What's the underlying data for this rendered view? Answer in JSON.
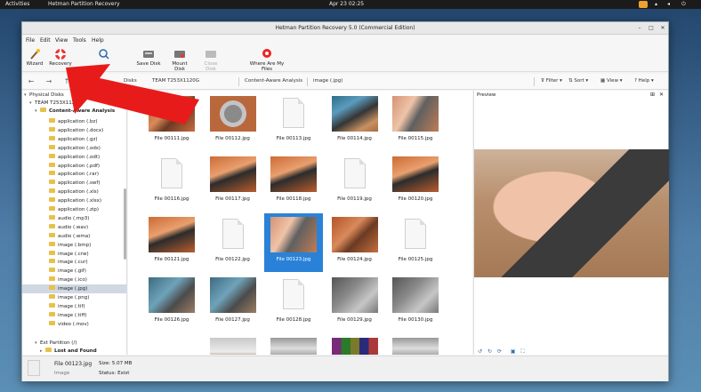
{
  "topbar": {
    "activities": "Activities",
    "app": "Hetman Partition Recovery",
    "clock": "Apr 23  02:25"
  },
  "window": {
    "title": "Hetman Partition Recovery 5.0 (Commercial Edition)"
  },
  "menu": [
    "File",
    "Edit",
    "View",
    "Tools",
    "Help"
  ],
  "toolbar": {
    "wizard": "Wizard",
    "recovery": "Recovery",
    "save_disk": "Save Disk",
    "mount_disk": "Mount Disk",
    "close_disk": "Close Disk",
    "where": "Where Are My Files"
  },
  "breadcrumbs": [
    "Disks",
    "TEAM T253X1120G",
    "Content-Aware Analysis",
    "image (.jpg)"
  ],
  "right_tools": {
    "filter": "Filter",
    "sort": "Sort",
    "view": "View",
    "help": "Help"
  },
  "tree": {
    "physical": "Physical Disks",
    "disk": "TEAM T253X1120G",
    "analysis": "Content-Aware Analysis",
    "items": [
      "application (.bz)",
      "application (.docx)",
      "application (.gz)",
      "application (.ods)",
      "application (.odt)",
      "application (.pdf)",
      "application (.rar)",
      "application (.swf)",
      "application (.xls)",
      "application (.xlsx)",
      "application (.zip)",
      "audio (.mp3)",
      "audio (.wav)",
      "audio (.wma)",
      "image (.bmp)",
      "image (.crw)",
      "image (.cur)",
      "image (.gif)",
      "image (.ico)",
      "image (.jpg)",
      "image (.png)",
      "image (.tif)",
      "image (.tiff)",
      "video (.mov)"
    ],
    "ext": "Ext Partition (/)",
    "lost": "Lost and Found"
  },
  "files": [
    "File 00111.jpg",
    "File 00112.jpg",
    "File 00113.jpg",
    "File 00114.jpg",
    "File 00115.jpg",
    "File 00116.jpg",
    "File 00117.jpg",
    "File 00118.jpg",
    "File 00119.jpg",
    "File 00120.jpg",
    "File 00121.jpg",
    "File 00122.jpg",
    "File 00123.jpg",
    "File 00124.jpg",
    "File 00125.jpg",
    "File 00126.jpg",
    "File 00127.jpg",
    "File 00128.jpg",
    "File 00129.jpg",
    "File 00130.jpg"
  ],
  "preview": {
    "title": "Preview"
  },
  "status": {
    "file": "File 00123.jpg",
    "type": "Image",
    "size": "Size: 5.07 MB",
    "state": "Status: Exist"
  }
}
